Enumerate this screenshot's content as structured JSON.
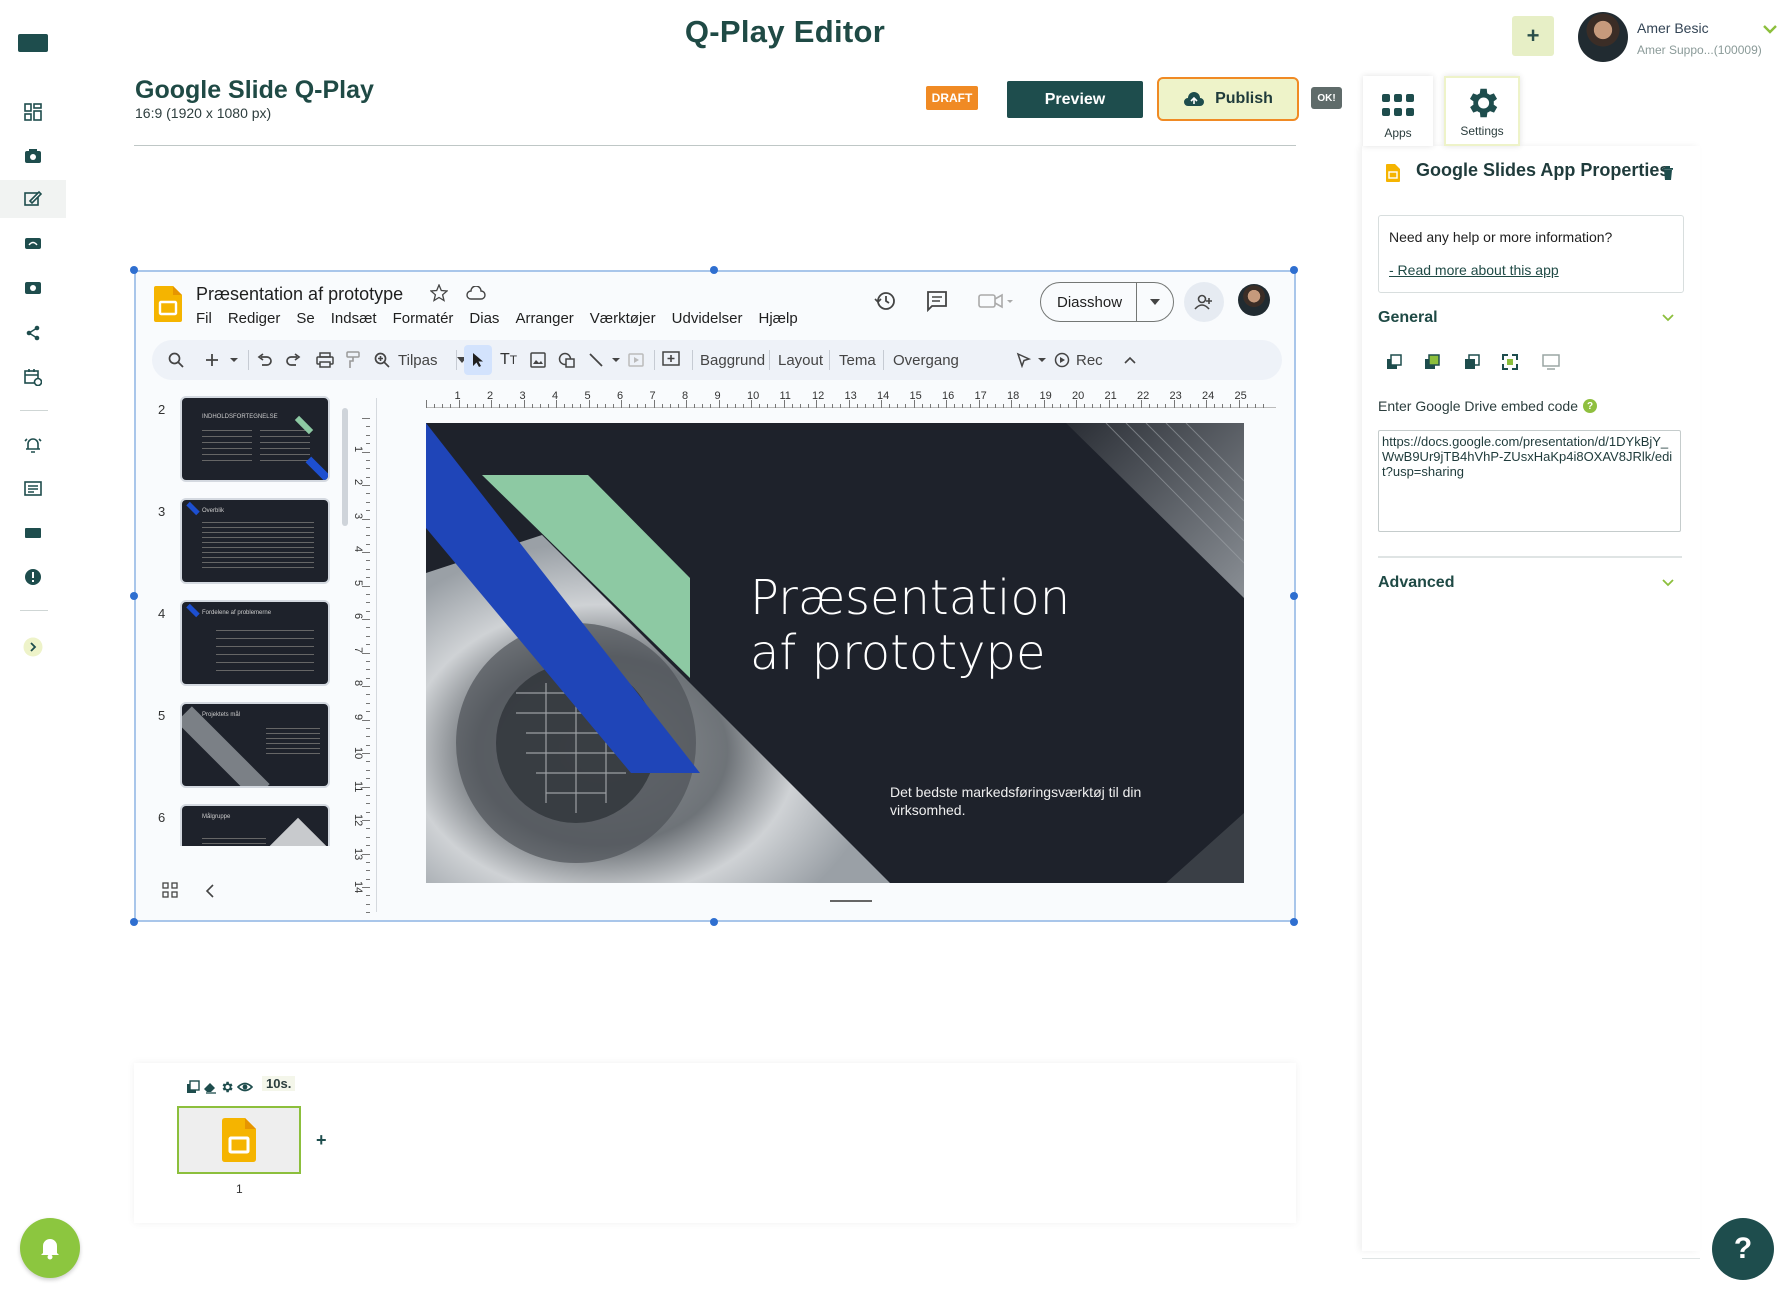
{
  "header": {
    "app_title": "Q-Play Editor",
    "add_label": "+",
    "user_name": "Amer Besic",
    "user_role": "Amer Suppo...(100009)"
  },
  "document": {
    "title": "Google Slide Q-Play",
    "resolution": "16:9 (1920 x 1080 px)",
    "status_badge": "DRAFT",
    "preview_label": "Preview",
    "publish_label": "Publish",
    "ok_badge": "OK!"
  },
  "slides_app": {
    "presentation_title": "Præsentation af prototype",
    "menu": [
      "Fil",
      "Rediger",
      "Se",
      "Indsæt",
      "Formatér",
      "Dias",
      "Arranger",
      "Værktøjer",
      "Udvidelser",
      "Hjælp"
    ],
    "slideshow_label": "Diasshow",
    "toolbar": {
      "zoom_label": "Tilpas",
      "background": "Baggrund",
      "layout": "Layout",
      "theme": "Tema",
      "transition": "Overgang",
      "rec": "Rec"
    },
    "thumbnails": [
      {
        "number": "2",
        "heading": "INDHOLDSFORTEGNELSE"
      },
      {
        "number": "3",
        "heading": "Overblik"
      },
      {
        "number": "4",
        "heading": "Fordelene af problemerne"
      },
      {
        "number": "5",
        "heading": "Projektets mål"
      },
      {
        "number": "6",
        "heading": "Målgruppe"
      }
    ],
    "ruler_h": [
      "1",
      "2",
      "3",
      "4",
      "5",
      "6",
      "7",
      "8",
      "9",
      "10",
      "11",
      "12",
      "13",
      "14",
      "15",
      "16",
      "17",
      "18",
      "19",
      "20",
      "21",
      "22",
      "23",
      "24",
      "25"
    ],
    "ruler_v": [
      "1",
      "2",
      "3",
      "4",
      "5",
      "6",
      "7",
      "8",
      "9",
      "10",
      "11",
      "12",
      "13",
      "14"
    ],
    "slide": {
      "title_line1": "Præsentation",
      "title_line2": "af prototype",
      "subtitle": "Det bedste markedsføringsværktøj til din virksomhed."
    }
  },
  "right_panel": {
    "tabs": [
      {
        "label": "Apps"
      },
      {
        "label": "Settings"
      }
    ],
    "title": "Google Slides App Properties",
    "help_question": "Need any help or more information?",
    "help_link": "- Read more about this app",
    "general_label": "General",
    "embed_label": "Enter Google Drive embed code",
    "embed_value": "https://docs.google.com/presentation/d/1DYkBjY_WwB9Ur9jTB4hVhP-ZUsxHaKp4i8OXAV8JRlk/edit?usp=sharing",
    "advanced_label": "Advanced"
  },
  "timeline": {
    "duration": "10s.",
    "slide_number": "1",
    "add_label": "+"
  },
  "help_fab": "?",
  "colors": {
    "brand_dark": "#1e4d4d",
    "brand_green": "#8cc63f",
    "draft_orange": "#f08a24"
  }
}
